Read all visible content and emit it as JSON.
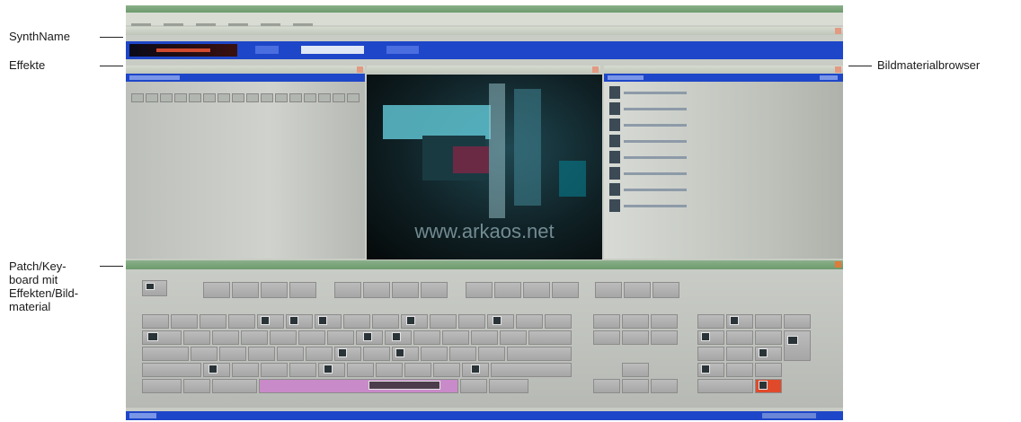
{
  "callouts": {
    "synthname": "SynthName",
    "effekte": "Effekte",
    "browser": "Bildmaterialbrowser",
    "patch_lines": [
      "Patch/Key-",
      "board mit",
      "Effekten/Bild-",
      "material"
    ]
  },
  "preview": {
    "watermark": "www.arkaos.net"
  },
  "colors": {
    "title_green": "#7aa57a",
    "toolbar_blue": "#1e46c8",
    "patch_pink": "#c98ac9",
    "accent_red": "#e04a2a",
    "key_gray": "#b4b4b4"
  },
  "icons": [
    "window-close-icon",
    "gear-icon",
    "effect-icon"
  ]
}
